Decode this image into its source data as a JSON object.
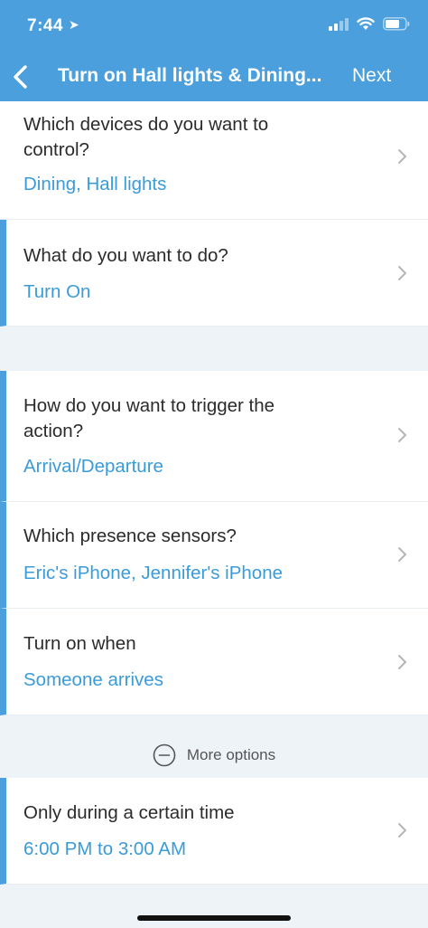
{
  "status_bar": {
    "time": "7:44",
    "location_glyph": "➤"
  },
  "header": {
    "title": "Turn on Hall lights & Dining...",
    "next_label": "Next"
  },
  "sections": [
    {
      "question": "Which devices do you want to control?",
      "answer": "Dining, Hall lights"
    },
    {
      "question": "What do you want to do?",
      "answer": "Turn On"
    },
    {
      "question": "How do you want to trigger the action?",
      "answer": "Arrival/Departure"
    },
    {
      "question": "Which presence sensors?",
      "answer": "Eric's iPhone, Jennifer's iPhone"
    },
    {
      "question": "Turn on when",
      "answer": "Someone arrives"
    },
    {
      "question": "Only during a certain time",
      "answer": "6:00 PM to 3:00 AM"
    }
  ],
  "more_options": {
    "label": "More options",
    "icon": "minus-circle-icon"
  },
  "colors": {
    "brand": "#4a9fdc",
    "answer": "#3a9bd9",
    "background": "#eef3f8"
  }
}
